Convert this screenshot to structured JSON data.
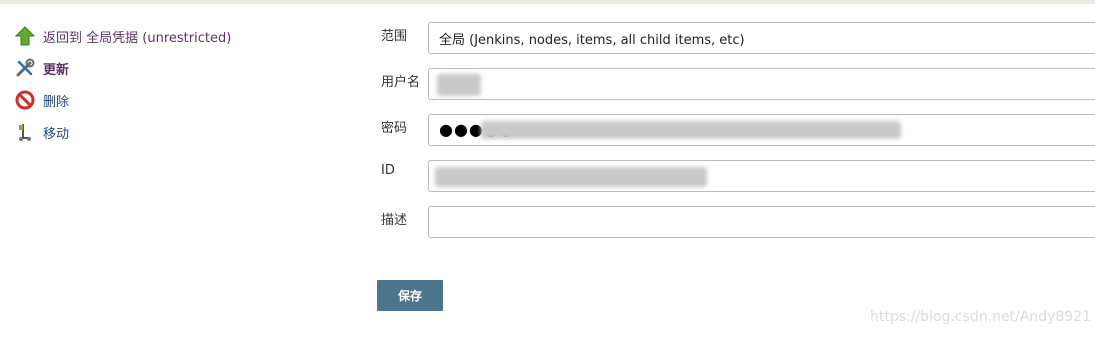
{
  "side_panel": {
    "items": [
      {
        "label": "返回到 全局凭据 (unrestricted)",
        "icon": "up-arrow-icon"
      },
      {
        "label": "更新",
        "icon": "wrench-screwdriver-icon"
      },
      {
        "label": "删除",
        "icon": "no-entry-icon"
      },
      {
        "label": "移动",
        "icon": "mover-icon"
      }
    ]
  },
  "form": {
    "scope_label": "范围",
    "scope_value": "全局 (Jenkins, nodes, items, all child items, etc)",
    "username_label": "用户名",
    "password_label": "密码",
    "password_dots": "●●●●●",
    "id_label": "ID",
    "description_label": "描述",
    "save_label": "保存"
  },
  "watermark": "https://blog.csdn.net/Andy8921",
  "colors": {
    "accent_button": "#4b758b",
    "link": "#204a87",
    "visited_link": "#5c3566"
  }
}
